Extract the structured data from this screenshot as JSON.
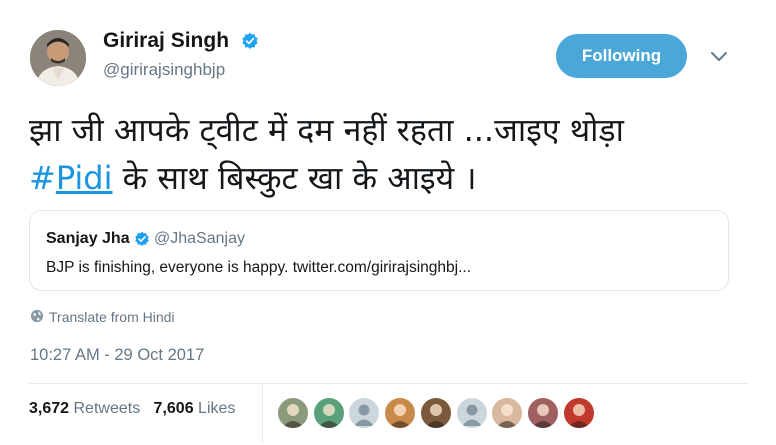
{
  "author": {
    "name": "Giriraj Singh",
    "handle": "@girirajsinghbjp",
    "verified_icon": "verified-badge-icon",
    "avatar_icon": "profile-photo"
  },
  "follow_button": {
    "label": "Following",
    "color": "#4aa7d7"
  },
  "menu": {
    "icon": "chevron-down-icon"
  },
  "tweet": {
    "text_line1": "झा जी आपके ट्वीट में दम नहीं रहता ...जाइए थोड़ा",
    "hashtag_symbol": "#",
    "hashtag_word": "Pidi",
    "text_line2_rest": " के साथ बिस्कुट खा के आइये ।"
  },
  "quoted_tweet": {
    "name": "Sanjay Jha",
    "handle": "@JhaSanjay",
    "text": "BJP is finishing, everyone is happy. twitter.com/girirajsinghbj..."
  },
  "translate": {
    "label": "Translate from Hindi",
    "icon": "globe-icon"
  },
  "timestamp": "10:27 AM - 29 Oct 2017",
  "stats": {
    "retweets_count": "3,672",
    "retweets_label": "Retweets",
    "likes_count": "7,606",
    "likes_label": "Likes"
  },
  "likers": [
    {
      "icon": "liker-avatar-1",
      "color": "#8a9a7a"
    },
    {
      "icon": "liker-avatar-2",
      "color": "#5aa07a"
    },
    {
      "icon": "liker-avatar-default",
      "color": "#ccd6dd"
    },
    {
      "icon": "liker-avatar-4",
      "color": "#c98a4a"
    },
    {
      "icon": "liker-avatar-5",
      "color": "#7a5a3a"
    },
    {
      "icon": "liker-avatar-default",
      "color": "#ccd6dd"
    },
    {
      "icon": "liker-avatar-7",
      "color": "#d9b8a0"
    },
    {
      "icon": "liker-avatar-8",
      "color": "#a06060"
    },
    {
      "icon": "liker-avatar-9",
      "color": "#c0392b"
    }
  ],
  "colors": {
    "link": "#1b95e0",
    "muted": "#657786",
    "text": "#14171a"
  }
}
